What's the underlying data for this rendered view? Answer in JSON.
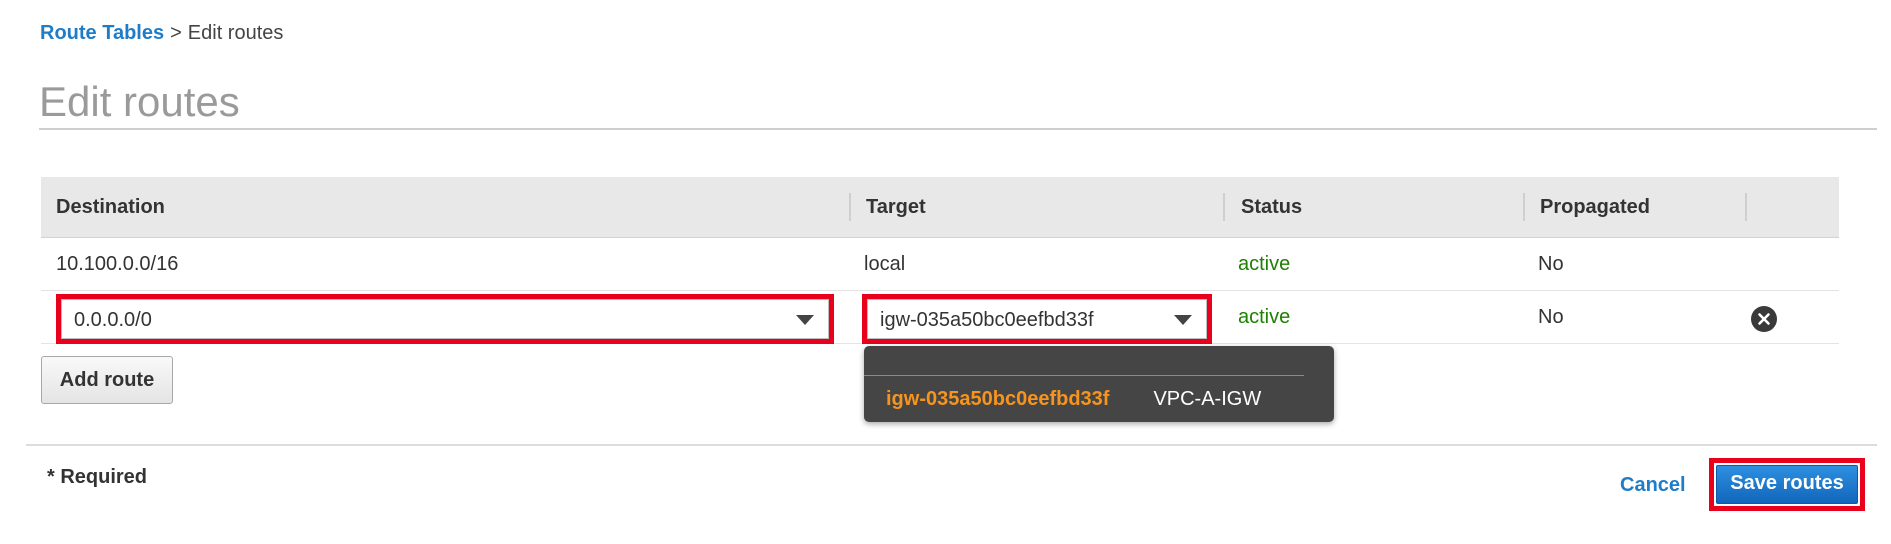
{
  "breadcrumb": {
    "link": "Route Tables",
    "separator": ">",
    "current": "Edit routes"
  },
  "page_title": "Edit routes",
  "table": {
    "headers": {
      "destination": "Destination",
      "target": "Target",
      "status": "Status",
      "propagated": "Propagated"
    },
    "rows": [
      {
        "destination": "10.100.0.0/16",
        "target": "local",
        "status": "active",
        "propagated": "No"
      },
      {
        "destination": "0.0.0.0/0",
        "target": "igw-035a50bc0eefbd33f",
        "status": "active",
        "propagated": "No",
        "removable": true
      }
    ]
  },
  "add_route_label": "Add route",
  "target_dropdown": {
    "options": [
      {
        "id": "igw-035a50bc0eefbd33f",
        "name": "VPC-A-IGW"
      }
    ]
  },
  "footer": {
    "required_note": "* Required",
    "cancel_label": "Cancel",
    "save_label": "Save routes"
  },
  "colors": {
    "link": "#1f7dc8",
    "status_active": "#1d8102",
    "highlight_outline": "#e8001c",
    "option_highlight": "#f7941d",
    "primary_button": "#1f78d1"
  },
  "icons": {
    "remove": "close-circle-icon",
    "dropdown": "caret-down-icon"
  }
}
